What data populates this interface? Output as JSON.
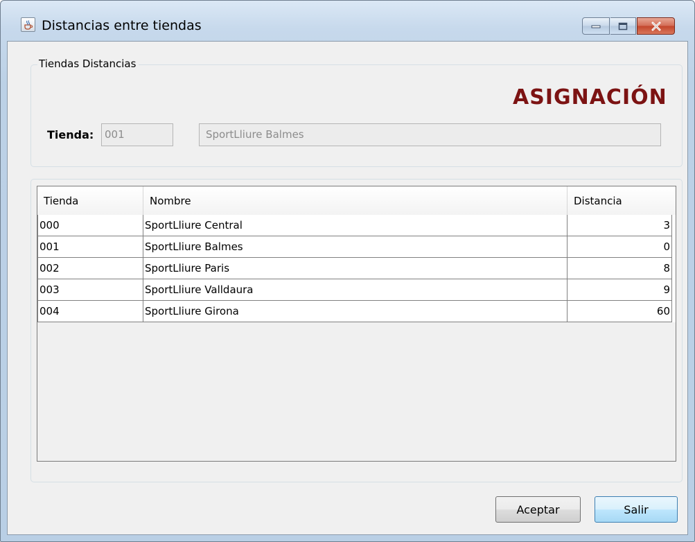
{
  "window": {
    "title": "Distancias entre tiendas",
    "icon": "java-cup-icon"
  },
  "group": {
    "label": "Tiendas Distancias",
    "brand": "ASIGNACIÓN",
    "brand_color": "#7c1313",
    "tienda_label": "Tienda:",
    "tienda_code": "001",
    "tienda_name": "SportLliure Balmes"
  },
  "table": {
    "columns": [
      "Tienda",
      "Nombre",
      "Distancia"
    ],
    "rows": [
      [
        "000",
        "SportLliure Central",
        "3"
      ],
      [
        "001",
        "SportLliure Balmes",
        "0"
      ],
      [
        "002",
        "SportLliure Paris",
        "8"
      ],
      [
        "003",
        "SportLliure Valldaura",
        "9"
      ],
      [
        "004",
        "SportLliure Girona",
        "60"
      ]
    ]
  },
  "buttons": {
    "accept": "Aceptar",
    "exit": "Salir"
  }
}
